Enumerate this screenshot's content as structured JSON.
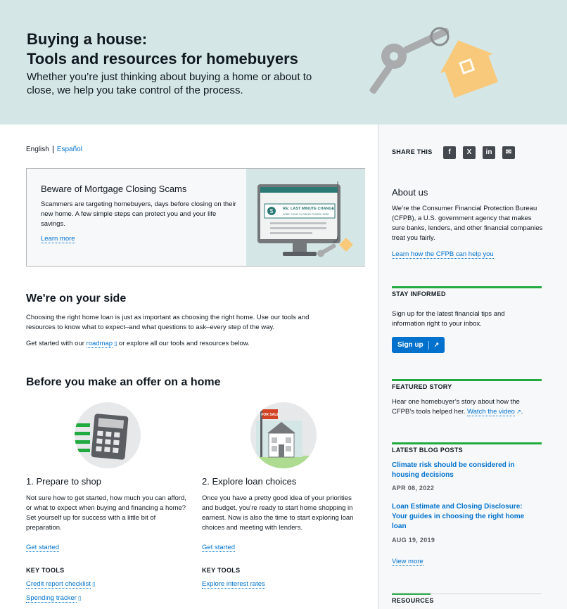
{
  "hero": {
    "title_line1": "Buying a house:",
    "title_line2": "Tools and resources for homebuyers",
    "lead": "Whether you’re just thinking about buying a home or about to close, we help you take control of the process."
  },
  "language": {
    "current": "English",
    "other": "Español"
  },
  "alert": {
    "title": "Beware of Mortgage Closing Scams",
    "body": "Scammers are targeting homebuyers, days before closing on their new home. A few simple steps can protect you and your life savings.",
    "link": "Learn more",
    "screen_line1": "RE: LAST MINUTE CHANGE",
    "screen_line2": "WIRE YOUR CLOSING FUNDS HERE",
    "dollar": "$"
  },
  "side_section": {
    "title": "We're on your side",
    "para1": "Choosing the right home loan is just as important as choosing the right home. Use our tools and resources to know what to expect–and what questions to ask–every step of the way.",
    "para2_pre": "Get started with our",
    "para2_link": "roadmap",
    "para2_post": "or explore all our tools and resources below."
  },
  "offer": {
    "title": "Before you make an offer on a home",
    "cols": [
      {
        "heading": "1. Prepare to shop",
        "body": "Not sure how to get started, how much you can afford, or what to expect when buying and financing a home? Set yourself up for success with a little bit of preparation.",
        "link": "Get started",
        "key_tools": "KEY TOOLS",
        "tools": [
          "Credit report checklist",
          "Spending tracker"
        ]
      },
      {
        "heading": "2. Explore loan choices",
        "body": "Once you have a pretty good idea of your priorities and budget, you’re ready to start home shopping in earnest. Now is also the time to start exploring loan choices and meeting with lenders.",
        "link": "Get started",
        "key_tools": "KEY TOOLS",
        "tools": [
          "Explore interest rates"
        ],
        "sign": "FOR SALE"
      }
    ]
  },
  "sidebar": {
    "share_label": "SHARE THIS",
    "share_icons": [
      "facebook-icon",
      "x-icon",
      "linkedin-icon",
      "email-icon"
    ],
    "about_title": "About us",
    "about_body": "We’re the Consumer Financial Protection Bureau (CFPB), a U.S. government agency that makes sure banks, lenders, and other financial companies treat you fairly.",
    "about_link": "Learn how the CFPB can help you",
    "stay_title": "STAY INFORMED",
    "stay_body": "Sign up for the latest financial tips and information right to your inbox.",
    "signup_label": "Sign up",
    "featured_title": "FEATURED STORY",
    "featured_body": "Hear one homebuyer’s story about how the CFPB’s tools helped her.",
    "featured_link": "Watch the video",
    "blog_title": "LATEST BLOG POSTS",
    "posts": [
      {
        "title": "Climate risk should be considered in housing decisions",
        "date": "APR 08, 2022"
      },
      {
        "title": "Loan Estimate and Closing Disclosure: Your guides in choosing the right home loan",
        "date": "AUG 19, 2019"
      }
    ],
    "view_more": "View more",
    "resources_title": "RESOURCES"
  },
  "colors": {
    "accent": "#0072ce",
    "green": "#20aa3f",
    "hero_bg": "#d4e7e6",
    "house": "#f8c97a"
  }
}
